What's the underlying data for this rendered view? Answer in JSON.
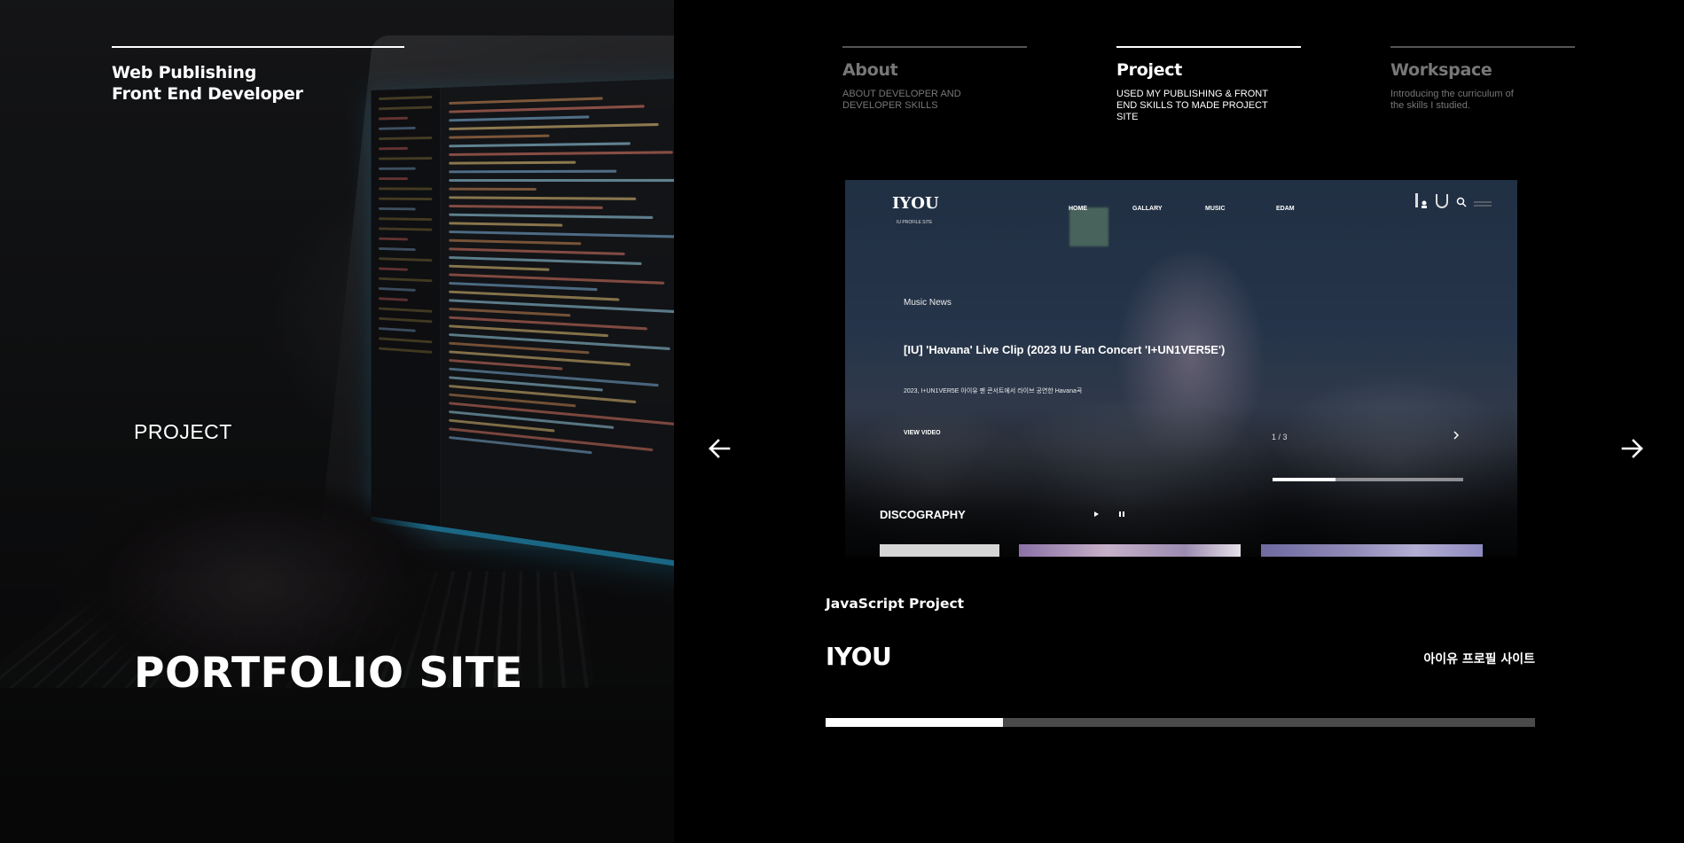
{
  "hero": {
    "subtitle_line1": "Web Publishing",
    "subtitle_line2": "Front End Developer",
    "section_label": "PROJECT",
    "title": "PORTFOLIO SITE"
  },
  "nav": {
    "items": [
      {
        "name": "About",
        "desc_line1": "ABOUT DEVELOPER AND",
        "desc_line2": "DEVELOPER SKILLS",
        "desc_line3": "",
        "active": false
      },
      {
        "name": "Project",
        "desc_line1": "USED MY PUBLISHING & FRONT",
        "desc_line2": "END SKILLS TO MADE PROJECT",
        "desc_line3": "SITE",
        "active": true
      },
      {
        "name": "Workspace",
        "desc_line1": "Introducing the curriculum of",
        "desc_line2": "the skills I studied.",
        "desc_line3": "",
        "active": false
      }
    ]
  },
  "arrows": {
    "prev_icon": "arrow-left-icon",
    "next_icon": "arrow-right-icon"
  },
  "preview": {
    "logo": "IYOU",
    "logo_sub": "IU PROFILE SITE",
    "nav": [
      "HOME",
      "GALLARY",
      "MUSIC",
      "EDAM"
    ],
    "kicker": "Music News",
    "headline": "[IU] 'Havana' Live Clip (2023 IU Fan Concert 'I+UN1VER5E')",
    "description": "2023, I+UN1VER5E 아이유 팬 콘서트에서 라이브 공연한 Havana곡",
    "view_video": "VIEW VIDEO",
    "counter": "1 / 3",
    "slide_progress": 0.33,
    "discography": "DISCOGRAPHY"
  },
  "project": {
    "type": "JavaScript Project",
    "name": "IYOU",
    "korean_title": "아이유 프로필 사이트",
    "progress": 0.25
  },
  "colors": {
    "background": "#000000",
    "accent": "#ffffff",
    "inactive": "#777777"
  }
}
